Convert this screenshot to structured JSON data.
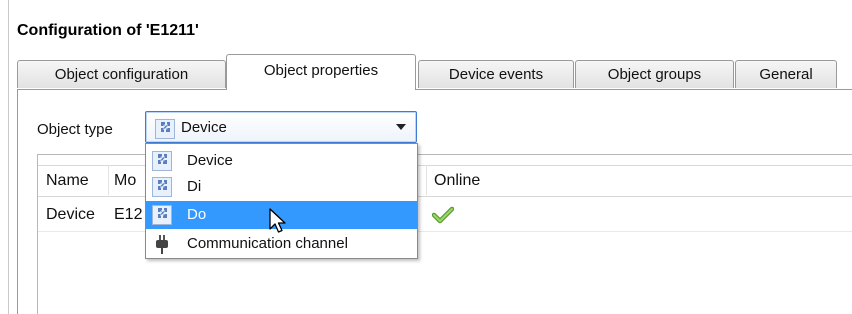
{
  "window": {
    "title": "Configuration of 'E1211'"
  },
  "tabs": [
    {
      "label": "Object configuration",
      "active": false
    },
    {
      "label": "Object properties",
      "active": true
    },
    {
      "label": "Device events",
      "active": false
    },
    {
      "label": "Object groups",
      "active": false
    },
    {
      "label": "General",
      "active": false
    }
  ],
  "object_type": {
    "label": "Object type",
    "selected_value": "Device",
    "options": [
      {
        "label": "Device",
        "icon": "puzzle-icon"
      },
      {
        "label": "Di",
        "icon": "puzzle-icon"
      },
      {
        "label": "Do",
        "icon": "puzzle-icon",
        "highlighted": true
      },
      {
        "label": "Communication channel",
        "icon": "plug-icon"
      }
    ]
  },
  "table": {
    "columns": [
      "Name",
      "Mo",
      "Online"
    ],
    "rows": [
      {
        "name": "Device",
        "model": "E12",
        "online": "check-icon"
      }
    ]
  },
  "colors": {
    "highlight": "#3399ff",
    "combo_border": "#3d7bd6",
    "check": "#7cc243"
  }
}
